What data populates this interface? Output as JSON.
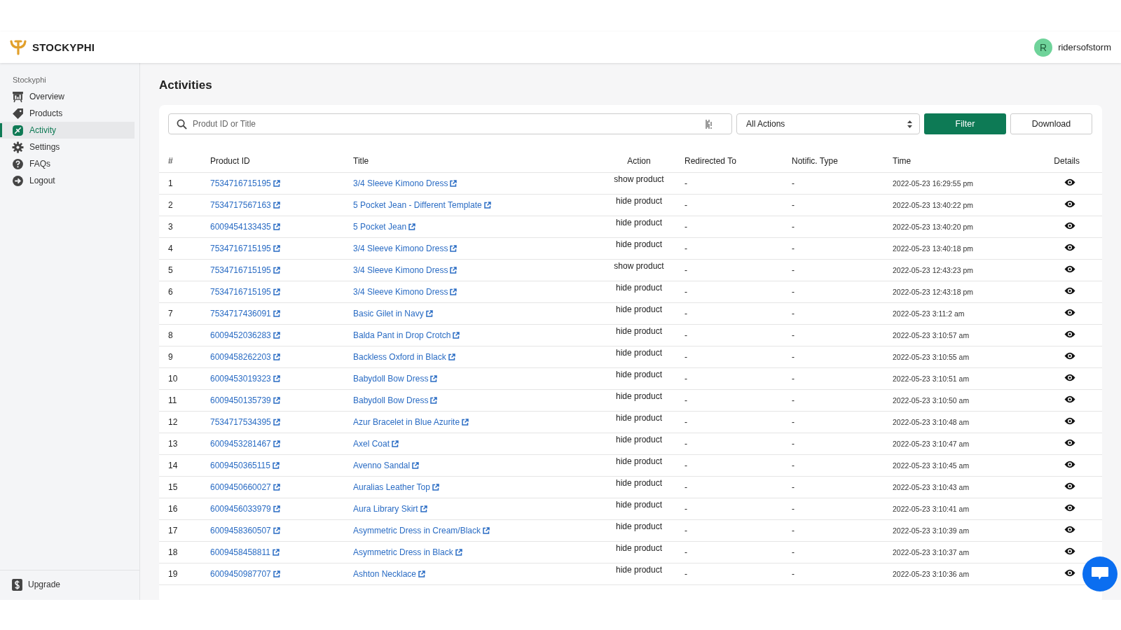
{
  "brand": {
    "name": "STOCKYPHI"
  },
  "user": {
    "initial": "R",
    "name": "ridersofstorm"
  },
  "sidebar": {
    "section": "Stockyphi",
    "items": [
      {
        "label": "Overview",
        "selected": false
      },
      {
        "label": "Products",
        "selected": false
      },
      {
        "label": "Activity",
        "selected": true
      },
      {
        "label": "Settings",
        "selected": false
      },
      {
        "label": "FAQs",
        "selected": false
      },
      {
        "label": "Logout",
        "selected": false
      }
    ],
    "footer": {
      "label": "Upgrade"
    }
  },
  "page": {
    "title": "Activities"
  },
  "toolbar": {
    "search": {
      "placeholder": "Produt ID or Title"
    },
    "select": {
      "value": "All Actions"
    },
    "buttons": [
      "Filter",
      "Download"
    ]
  },
  "table": {
    "columns": [
      "#",
      "Product ID",
      "Title",
      "Action",
      "Redirected To",
      "Notific. Type",
      "Time",
      "Details"
    ],
    "rows": [
      {
        "n": "1",
        "id": "7534716715195",
        "title": "3/4 Sleeve Kimono Dress",
        "action": "show product",
        "redirected": "-",
        "type": "-",
        "time": "2022-05-23 16:29:55 pm"
      },
      {
        "n": "2",
        "id": "7534717567163",
        "title": "5 Pocket Jean - Different Template",
        "action": "hide product",
        "redirected": "-",
        "type": "-",
        "time": "2022-05-23 13:40:22 pm"
      },
      {
        "n": "3",
        "id": "6009454133435",
        "title": "5 Pocket Jean",
        "action": "hide product",
        "redirected": "-",
        "type": "-",
        "time": "2022-05-23 13:40:20 pm"
      },
      {
        "n": "4",
        "id": "7534716715195",
        "title": "3/4 Sleeve Kimono Dress",
        "action": "hide product",
        "redirected": "-",
        "type": "-",
        "time": "2022-05-23 13:40:18 pm"
      },
      {
        "n": "5",
        "id": "7534716715195",
        "title": "3/4 Sleeve Kimono Dress",
        "action": "show product",
        "redirected": "-",
        "type": "-",
        "time": "2022-05-23 12:43:23 pm"
      },
      {
        "n": "6",
        "id": "7534716715195",
        "title": "3/4 Sleeve Kimono Dress",
        "action": "hide product",
        "redirected": "-",
        "type": "-",
        "time": "2022-05-23 12:43:18 pm"
      },
      {
        "n": "7",
        "id": "7534717436091",
        "title": "Basic Gilet in Navy",
        "action": "hide product",
        "redirected": "-",
        "type": "-",
        "time": "2022-05-23 3:11:2 am"
      },
      {
        "n": "8",
        "id": "6009452036283",
        "title": "Balda Pant in Drop Crotch",
        "action": "hide product",
        "redirected": "-",
        "type": "-",
        "time": "2022-05-23 3:10:57 am"
      },
      {
        "n": "9",
        "id": "6009458262203",
        "title": "Backless Oxford in Black",
        "action": "hide product",
        "redirected": "-",
        "type": "-",
        "time": "2022-05-23 3:10:55 am"
      },
      {
        "n": "10",
        "id": "6009453019323",
        "title": "Babydoll Bow Dress",
        "action": "hide product",
        "redirected": "-",
        "type": "-",
        "time": "2022-05-23 3:10:51 am"
      },
      {
        "n": "11",
        "id": "6009450135739",
        "title": "Babydoll Bow Dress",
        "action": "hide product",
        "redirected": "-",
        "type": "-",
        "time": "2022-05-23 3:10:50 am"
      },
      {
        "n": "12",
        "id": "7534717534395",
        "title": "Azur Bracelet in Blue Azurite",
        "action": "hide product",
        "redirected": "-",
        "type": "-",
        "time": "2022-05-23 3:10:48 am"
      },
      {
        "n": "13",
        "id": "6009453281467",
        "title": "Axel Coat",
        "action": "hide product",
        "redirected": "-",
        "type": "-",
        "time": "2022-05-23 3:10:47 am"
      },
      {
        "n": "14",
        "id": "6009450365115",
        "title": "Avenno Sandal",
        "action": "hide product",
        "redirected": "-",
        "type": "-",
        "time": "2022-05-23 3:10:45 am"
      },
      {
        "n": "15",
        "id": "6009450660027",
        "title": "Auralias Leather Top",
        "action": "hide product",
        "redirected": "-",
        "type": "-",
        "time": "2022-05-23 3:10:43 am"
      },
      {
        "n": "16",
        "id": "6009456033979",
        "title": "Aura Library Skirt",
        "action": "hide product",
        "redirected": "-",
        "type": "-",
        "time": "2022-05-23 3:10:41 am"
      },
      {
        "n": "17",
        "id": "6009458360507",
        "title": "Asymmetric Dress in Cream/Black",
        "action": "hide product",
        "redirected": "-",
        "type": "-",
        "time": "2022-05-23 3:10:39 am"
      },
      {
        "n": "18",
        "id": "6009458458811",
        "title": "Asymmetric Dress in Black",
        "action": "hide product",
        "redirected": "-",
        "type": "-",
        "time": "2022-05-23 3:10:37 am"
      },
      {
        "n": "19",
        "id": "6009450987707",
        "title": "Ashton Necklace",
        "action": "hide product",
        "redirected": "-",
        "type": "-",
        "time": "2022-05-23 3:10:36 am"
      }
    ]
  }
}
